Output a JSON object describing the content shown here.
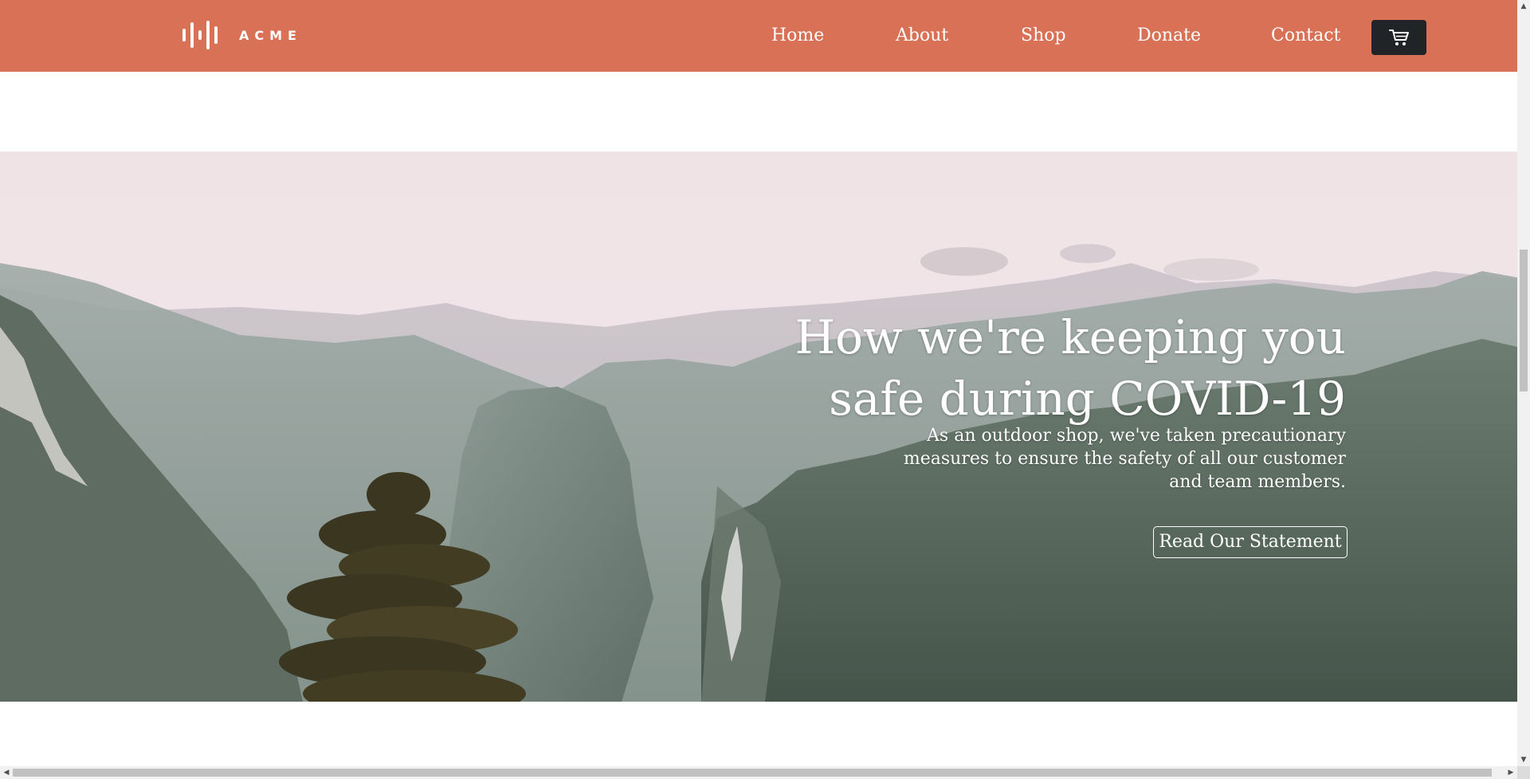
{
  "header": {
    "brand": "ACME",
    "nav": [
      {
        "label": "Home"
      },
      {
        "label": "About"
      },
      {
        "label": "Shop"
      },
      {
        "label": "Donate"
      },
      {
        "label": "Contact"
      }
    ],
    "cart_icon": "cart-icon"
  },
  "hero": {
    "title": "How we're keeping you safe during COVID-19",
    "description": "As an outdoor shop, we've taken precautionary measures to ensure the safety of all our customer and team members.",
    "button_label": "Read Our Statement"
  },
  "colors": {
    "header_bg": "#d97156",
    "cart_button_bg": "#202427",
    "hero_text": "#ffffff"
  },
  "scrollbars": {
    "vertical_up_icon": "chevron-up-icon",
    "vertical_down_icon": "chevron-down-icon",
    "horizontal_left_icon": "chevron-left-icon",
    "horizontal_right_icon": "chevron-right-icon"
  }
}
